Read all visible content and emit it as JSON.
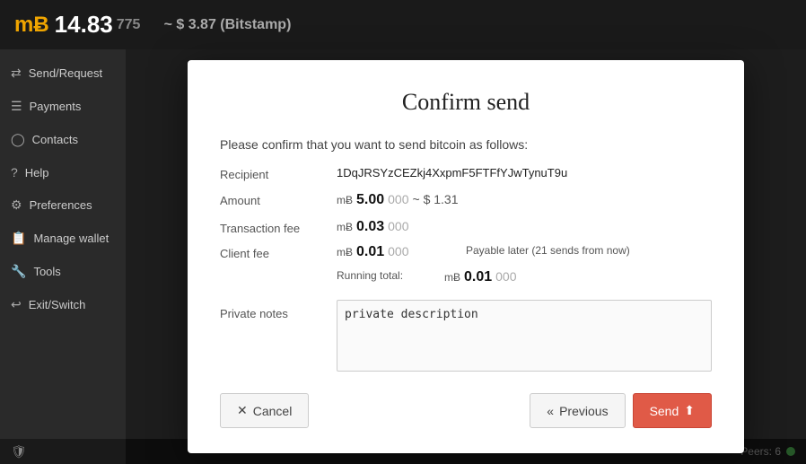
{
  "topbar": {
    "currency_icon": "mɃ",
    "amount_whole": "14.83",
    "amount_faint": "775",
    "approx_label": "~ $ 3.87 (Bitstamp)"
  },
  "sidebar": {
    "items": [
      {
        "id": "send-request",
        "icon": "⇄",
        "label": "Send/Request"
      },
      {
        "id": "payments",
        "icon": "≡",
        "label": "Payments"
      },
      {
        "id": "contacts",
        "icon": "👤",
        "label": "Contacts"
      },
      {
        "id": "help",
        "icon": "?",
        "label": "Help"
      },
      {
        "id": "preferences",
        "icon": "⚙",
        "label": "Preferences"
      },
      {
        "id": "manage-wallet",
        "icon": "📋",
        "label": "Manage wallet"
      },
      {
        "id": "tools",
        "icon": "🔧",
        "label": "Tools"
      },
      {
        "id": "exit-switch",
        "icon": "↩",
        "label": "Exit/Switch"
      }
    ]
  },
  "modal": {
    "title": "Confirm send",
    "intro": "Please confirm that you want to send bitcoin as follows:",
    "recipient_label": "Recipient",
    "recipient_value": "1DqJRSYzCEZkj4XxpmF5FTFfYJwTynuT9u",
    "amount_label": "Amount",
    "amount_btc_bold": "5.00",
    "amount_btc_faint": "000",
    "amount_approx": "~ $ 1.31",
    "tx_fee_label": "Transaction fee",
    "tx_fee_bold": "0.03",
    "tx_fee_faint": "000",
    "client_fee_label": "Client fee",
    "client_fee_bold": "0.01",
    "client_fee_faint": "000",
    "payable_later": "Payable later (21 sends from now)",
    "running_total_label": "Running total:",
    "running_total_bold": "0.01",
    "running_total_faint": "000",
    "notes_label": "Private notes",
    "notes_placeholder": "private description",
    "notes_value": "private description",
    "btn_cancel": "Cancel",
    "btn_previous": "Previous",
    "btn_send": "Send"
  },
  "statusbar": {
    "peers_label": "Peers: 6"
  }
}
